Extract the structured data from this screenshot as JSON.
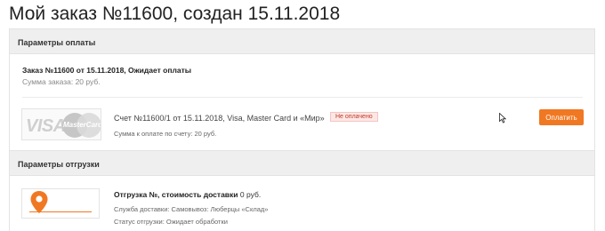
{
  "page_title": "Мой заказ №11600, создан 15.11.2018",
  "payment": {
    "section_title": "Параметры оплаты",
    "order_line": "Заказ №11600 от 15.11.2018, Ожидает оплаты",
    "order_sum": "Сумма заказа: 20 руб.",
    "logo_visa": "VISA",
    "logo_mastercard": "MasterCard",
    "bill_title": "Счет №11600/1 от 15.11.2018, Visa, Master Card и «Мир»",
    "status_badge": "Не оплачено",
    "bill_sum": "Сумма к оплате по счету: 20 руб.",
    "pay_button": "Оплатить",
    "status_color": "#c0392b",
    "accent_color": "#f07822"
  },
  "shipment": {
    "section_title": "Параметры отгрузки",
    "icon": "map-pin-icon",
    "title_bold": "Отгрузка №, стоимость доставки",
    "title_value": "0 руб.",
    "service": "Служба доставки: Самовывоз: Люберцы «Склад»",
    "status": "Статус отгрузки: Ожидает обработки"
  }
}
